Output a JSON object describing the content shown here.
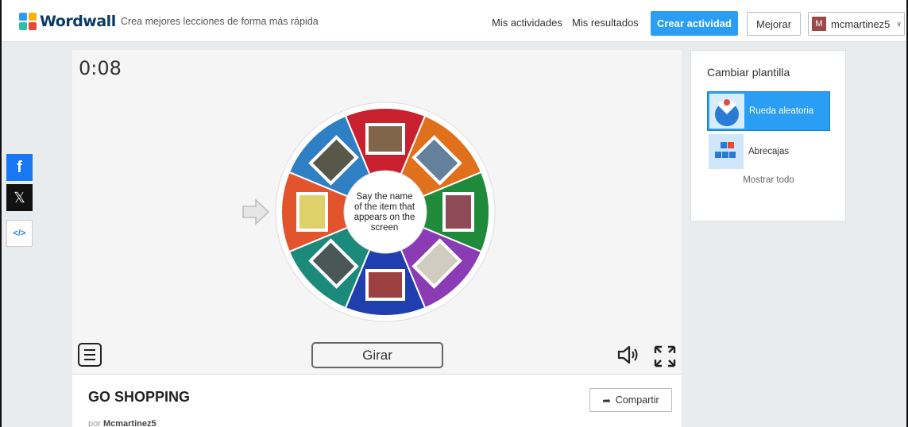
{
  "header": {
    "logo_text": "Wordwall",
    "tagline": "Crea mejores lecciones de forma más rápida",
    "nav": [
      "Mis actividades",
      "Mis resultados"
    ],
    "create_label": "Crear actividad",
    "improve_label": "Mejorar",
    "user": {
      "initial": "M",
      "name": "mcmartinez5"
    }
  },
  "social": {
    "facebook": "f",
    "x": "𝕏",
    "embed": "</>"
  },
  "game": {
    "timer": "0:08",
    "center_text": "Say the name of the item that appears on the screen",
    "spin_label": "Girar",
    "segment_colors": [
      "#c8202f",
      "#e0701c",
      "#1e8a3a",
      "#8b3cb5",
      "#1f3fae",
      "#1b8a7b",
      "#e2542b",
      "#2f7fc5"
    ],
    "segment_items": [
      "cashier photo",
      "store shelves photo",
      "shop display photo",
      "money photo",
      "clothes rack photo",
      "cash register photo",
      "sale tags photo",
      "shopping cart photo"
    ]
  },
  "activity": {
    "title": "GO SHOPPING",
    "share_label": "Compartir",
    "author_prefix": "por",
    "author": "Mcmartinez5"
  },
  "templates": {
    "title": "Cambiar plantilla",
    "items": [
      {
        "label": "Rueda aleatoria",
        "active": true,
        "icon": "wheel-icon"
      },
      {
        "label": "Abrecajas",
        "active": false,
        "icon": "boxes-icon"
      }
    ],
    "show_all": "Mostrar todo"
  }
}
